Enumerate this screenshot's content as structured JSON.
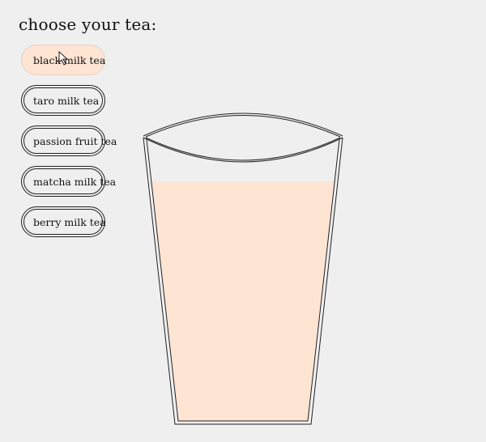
{
  "prompt": "choose your tea:",
  "teas": [
    {
      "label": "black milk tea",
      "selected": true
    },
    {
      "label": "taro milk tea",
      "selected": false
    },
    {
      "label": "passion fruit tea",
      "selected": false
    },
    {
      "label": "matcha milk tea",
      "selected": false
    },
    {
      "label": "berry milk tea",
      "selected": false
    }
  ],
  "glass": {
    "fill_color": "#fde4d3",
    "fill_level": 0.85
  }
}
